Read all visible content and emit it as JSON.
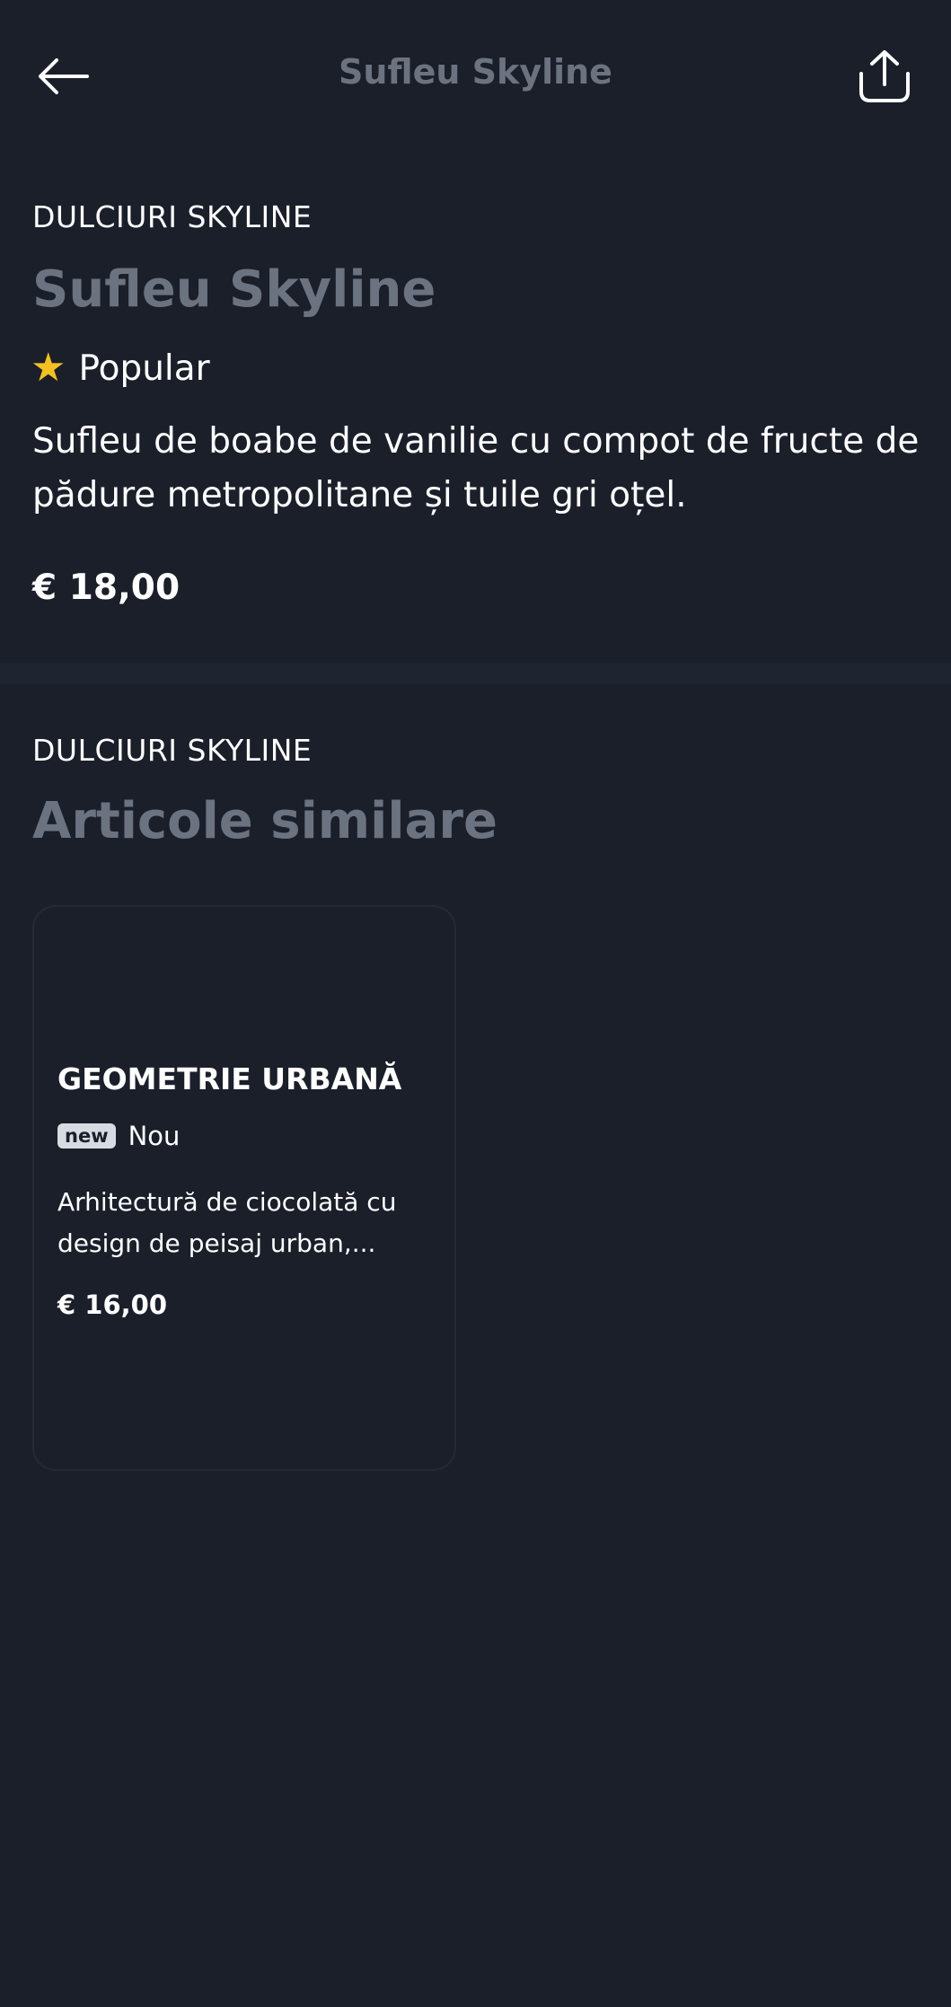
{
  "header": {
    "title": "Sufleu Skyline"
  },
  "product": {
    "category": "DULCIURI SKYLINE",
    "name": "Sufleu Skyline",
    "badge_label": "Popular",
    "description": "Sufleu de boabe de vanilie cu compot de fructe de pădure metropolitane și tuile gri oțel.",
    "price": "€ 18,00"
  },
  "similar": {
    "category": "DULCIURI SKYLINE",
    "heading": "Articole similare",
    "items": [
      {
        "title": "GEOMETRIE URBANĂ",
        "badge_tag": "new",
        "badge_label": "Nou",
        "description": "Arhitectură de ciocolată cu design de peisaj urban,...",
        "price": "€ 16,00"
      }
    ]
  },
  "colors": {
    "background": "#1a1f2a",
    "muted_title": "#6b7280",
    "star": "#f5c023",
    "text": "#ffffff"
  },
  "icons": {
    "back": "arrow-left-icon",
    "share": "share-icon",
    "popular": "star-icon"
  }
}
